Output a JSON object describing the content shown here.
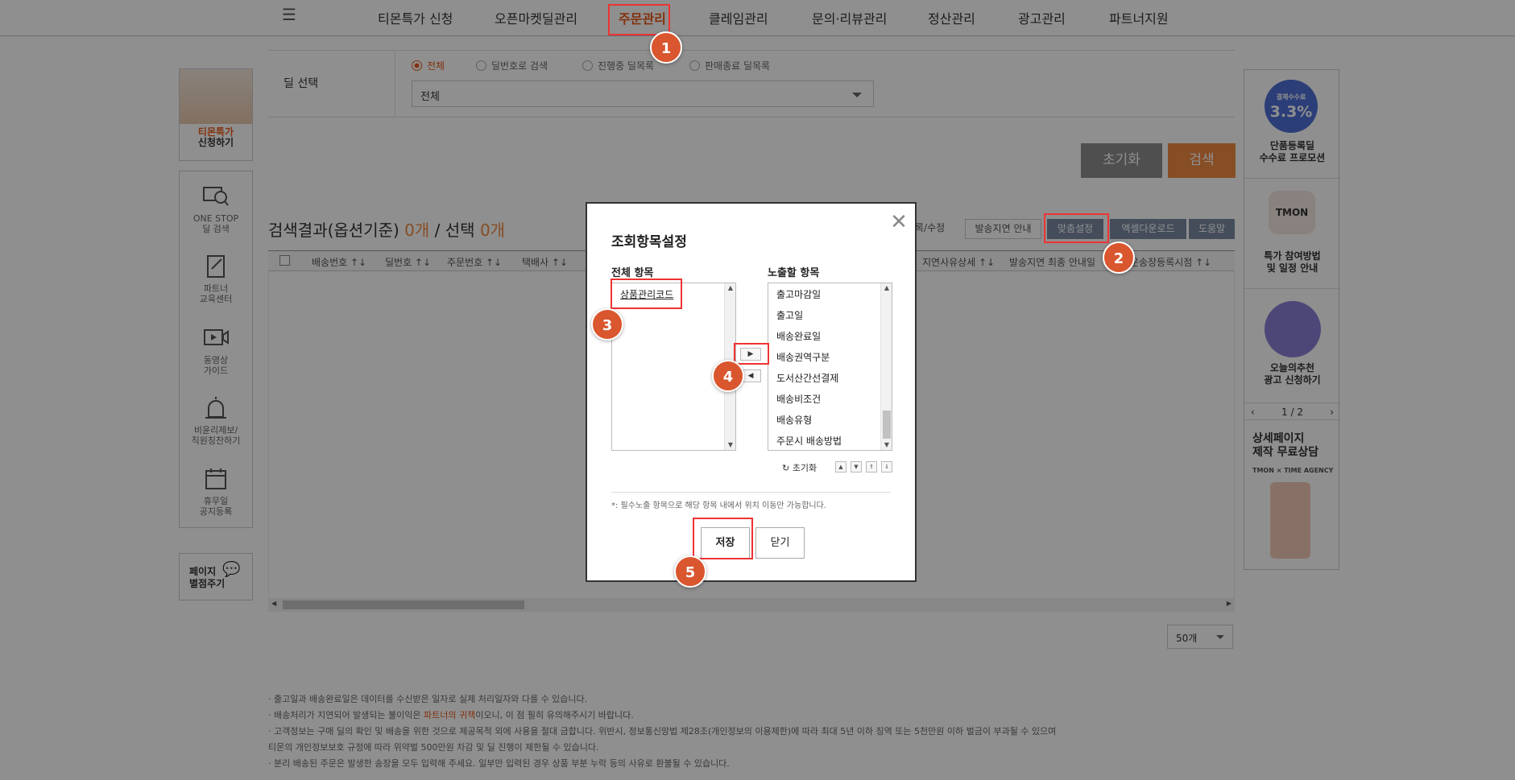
{
  "nav": {
    "items": [
      "티몬특가 신청",
      "오픈마켓딜관리",
      "주문관리",
      "클레임관리",
      "문의·리뷰관리",
      "정산관리",
      "광고관리",
      "파트너지원"
    ]
  },
  "left_sidebar": {
    "promo_line1": "티몬특가",
    "promo_line2": "신청하기",
    "items": [
      {
        "line1": "ONE STOP",
        "line2": "딜 검색"
      },
      {
        "line1": "파트너",
        "line2": "교육센터"
      },
      {
        "line1": "동영상",
        "line2": "가이드"
      },
      {
        "line1": "비윤리제보/",
        "line2": "직원칭찬하기"
      },
      {
        "line1": "휴무일",
        "line2": "공지등록"
      }
    ],
    "bookmark_line1": "페이지",
    "bookmark_line2": "별점주기"
  },
  "search_form": {
    "deal_label": "딜 선택",
    "radios": [
      "전체",
      "딜번호로 검색",
      "진행중 딜목록",
      "판매종료 딜목록"
    ],
    "select_value": "전체",
    "reset_button": "초기화",
    "search_button": "검색"
  },
  "results": {
    "title_prefix": "검색결과(옵션기준)",
    "count": "0개",
    "separator": "/",
    "selected_label": "선택",
    "selected_count": "0개",
    "buttons": [
      "록/수정",
      "발송지연 안내",
      "맞춤설정",
      "엑셀다운로드",
      "도움말"
    ],
    "columns": [
      "배송번호 ↑↓",
      "딜번호 ↑↓",
      "주문번호 ↑↓",
      "택배사 ↑↓",
      "지연사유상세 ↑↓",
      "발송지연 최종 안내일",
      "운송장등록시점 ↑↓"
    ],
    "page_size": "50개"
  },
  "notes": [
    "· 출고일과 배송완료일은 데이터를 수신받은 일자로 실제 처리일자와 다를 수 있습니다.",
    "· 배송처리가 지연되어 발생되는 불이익은 ",
    "파트너의 귀책",
    "이오니, 이 점 필히 유의해주시기 바랍니다.",
    "· 고객정보는 구매 딜의 확인 및 배송을 위한 것으로 제공목적 외에 사용을 절대 금합니다. 위반시, 정보통신망법 제28조(개인정보의 이용제한)에 따라 최대 5년 이하 징역 또는 5천만원 이하 벌금이 부과될 수 있으며",
    "  티몬의 개인정보보호 규정에 따라 위약벌 500만원 차감 및 딜 진행이 제한될 수 있습니다.",
    "· 분리 배송된 주문은 발생한 송장을 모두 입력해 주세요. 일부만 입력된 경우 상품 부분 누락 등의 사유로 환불될 수 있습니다."
  ],
  "right_sidebar": {
    "rate_label": "결제수수료",
    "rate": "3.3%",
    "promo1_line1": "단품등록딜",
    "promo1_line2": "수수료 프로모션",
    "tmon_logo": "TMON",
    "promo2_line1": "특가 참여방법",
    "promo2_line2": "및 일정 안내",
    "promo3_line1": "오늘의추천",
    "promo3_line2": "광고 신청하기",
    "pager": "1 / 2",
    "consult_line1": "상세페이지",
    "consult_line2": "제작 무료상담",
    "agency": "TMON × TIME AGENCY"
  },
  "modal": {
    "title": "조회항목설정",
    "all_label": "전체 항목",
    "all_items": [
      "상품관리코드"
    ],
    "shown_label": "노출할 항목",
    "shown_items": [
      "출고마감일",
      "출고일",
      "배송완료일",
      "배송권역구분",
      "도서산간선결제",
      "배송비조건",
      "배송유형",
      "주문시 배송방법"
    ],
    "reset_label": "초기화",
    "note": "*: 필수노출 항목으로 해당 항목 내에서 위치 이동만 가능합니다.",
    "save_button": "저장",
    "close_button": "닫기"
  },
  "annotations": [
    "1",
    "2",
    "3",
    "4",
    "5"
  ],
  "colors": {
    "accent": "#f08a43",
    "highlight": "#e33333",
    "badge": "#d9562e"
  }
}
